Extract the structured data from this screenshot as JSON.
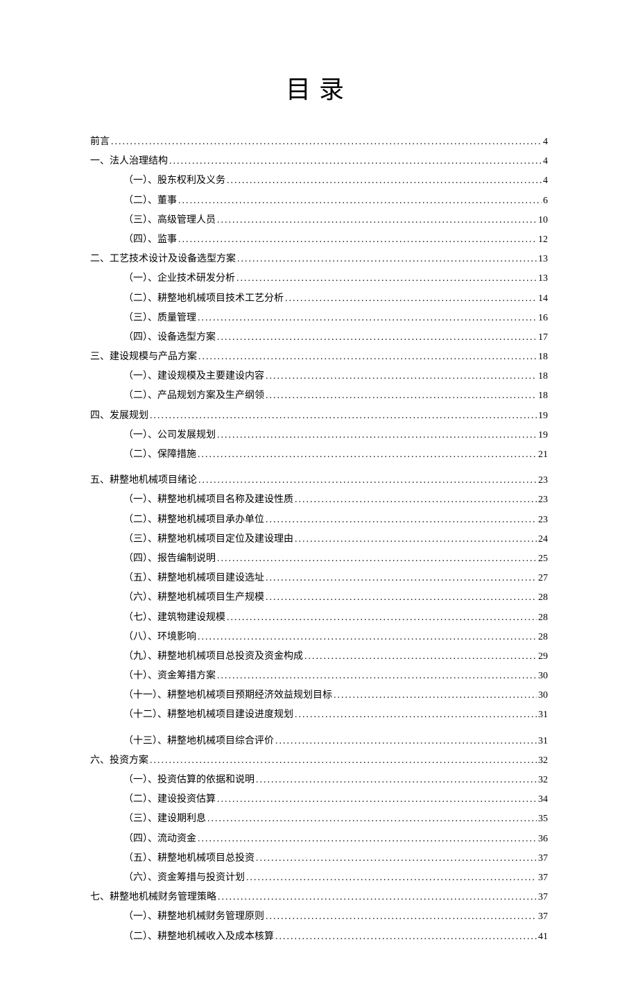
{
  "title": "目录",
  "entries": [
    {
      "level": 1,
      "label": "前言",
      "page": "4"
    },
    {
      "level": 1,
      "label": "一、法人治理结构",
      "page": "4"
    },
    {
      "level": 2,
      "label": "（一）、股东权利及义务",
      "page": "4"
    },
    {
      "level": 2,
      "label": "（二）、董事",
      "page": "6"
    },
    {
      "level": 2,
      "label": "（三）、高级管理人员",
      "page": "10"
    },
    {
      "level": 2,
      "label": "（四）、监事",
      "page": "12"
    },
    {
      "level": 1,
      "label": "二、工艺技术设计及设备选型方案",
      "page": "13"
    },
    {
      "level": 2,
      "label": "（一）、企业技术研发分析",
      "page": "13"
    },
    {
      "level": 2,
      "label": "（二）、耕整地机械项目技术工艺分析",
      "page": "14"
    },
    {
      "level": 2,
      "label": "（三）、质量管理",
      "page": "16"
    },
    {
      "level": 2,
      "label": "（四）、设备选型方案",
      "page": "17"
    },
    {
      "level": 1,
      "label": "三、建设规模与产品方案",
      "page": "18"
    },
    {
      "level": 2,
      "label": "（一）、建设规模及主要建设内容",
      "page": "18"
    },
    {
      "level": 2,
      "label": "（二）、产品规划方案及生产纲领",
      "page": "18"
    },
    {
      "level": 1,
      "label": "四、发展规划",
      "page": "19"
    },
    {
      "level": 2,
      "label": "（一）、公司发展规划",
      "page": "19"
    },
    {
      "level": 2,
      "label": "（二）、保障措施",
      "page": "21"
    },
    {
      "level": 1,
      "label": "五、耕整地机械项目绪论",
      "page": "23",
      "gap": true
    },
    {
      "level": 2,
      "label": "（一）、耕整地机械项目名称及建设性质",
      "page": "23"
    },
    {
      "level": 2,
      "label": "（二）、耕整地机械项目承办单位",
      "page": "23"
    },
    {
      "level": 2,
      "label": "（三）、耕整地机械项目定位及建设理由",
      "page": "24"
    },
    {
      "level": 2,
      "label": "（四）、报告编制说明",
      "page": "25"
    },
    {
      "level": 2,
      "label": "（五）、耕整地机械项目建设选址",
      "page": "27"
    },
    {
      "level": 2,
      "label": "（六）、耕整地机械项目生产规模",
      "page": "28"
    },
    {
      "level": 2,
      "label": "（七）、建筑物建设规模",
      "page": "28"
    },
    {
      "level": 2,
      "label": "（八）、环境影响",
      "page": "28"
    },
    {
      "level": 2,
      "label": "（九）、耕整地机械项目总投资及资金构成",
      "page": "29"
    },
    {
      "level": 2,
      "label": "（十）、资金筹措方案",
      "page": "30"
    },
    {
      "level": 2,
      "label": "（十一）、耕整地机械项目预期经济效益规划目标",
      "page": "30"
    },
    {
      "level": 2,
      "label": "（十二）、耕整地机械项目建设进度规划",
      "page": "31"
    },
    {
      "level": 2,
      "label": "（十三）、耕整地机械项目综合评价",
      "page": "31",
      "gap": true
    },
    {
      "level": 1,
      "label": "六、投资方案",
      "page": "32"
    },
    {
      "level": 2,
      "label": "（一）、投资估算的依据和说明",
      "page": "32"
    },
    {
      "level": 2,
      "label": "（二）、建设投资估算",
      "page": "34"
    },
    {
      "level": 2,
      "label": "（三）、建设期利息",
      "page": "35"
    },
    {
      "level": 2,
      "label": "（四）、流动资金",
      "page": "36"
    },
    {
      "level": 2,
      "label": "（五）、耕整地机械项目总投资",
      "page": "37"
    },
    {
      "level": 2,
      "label": "（六）、资金筹措与投资计划",
      "page": "37"
    },
    {
      "level": 1,
      "label": "七、耕整地机械财务管理策略",
      "page": "37"
    },
    {
      "level": 2,
      "label": "（一）、耕整地机械财务管理原则",
      "page": "37"
    },
    {
      "level": 2,
      "label": "（二）、耕整地机械收入及成本核算",
      "page": "41"
    }
  ]
}
